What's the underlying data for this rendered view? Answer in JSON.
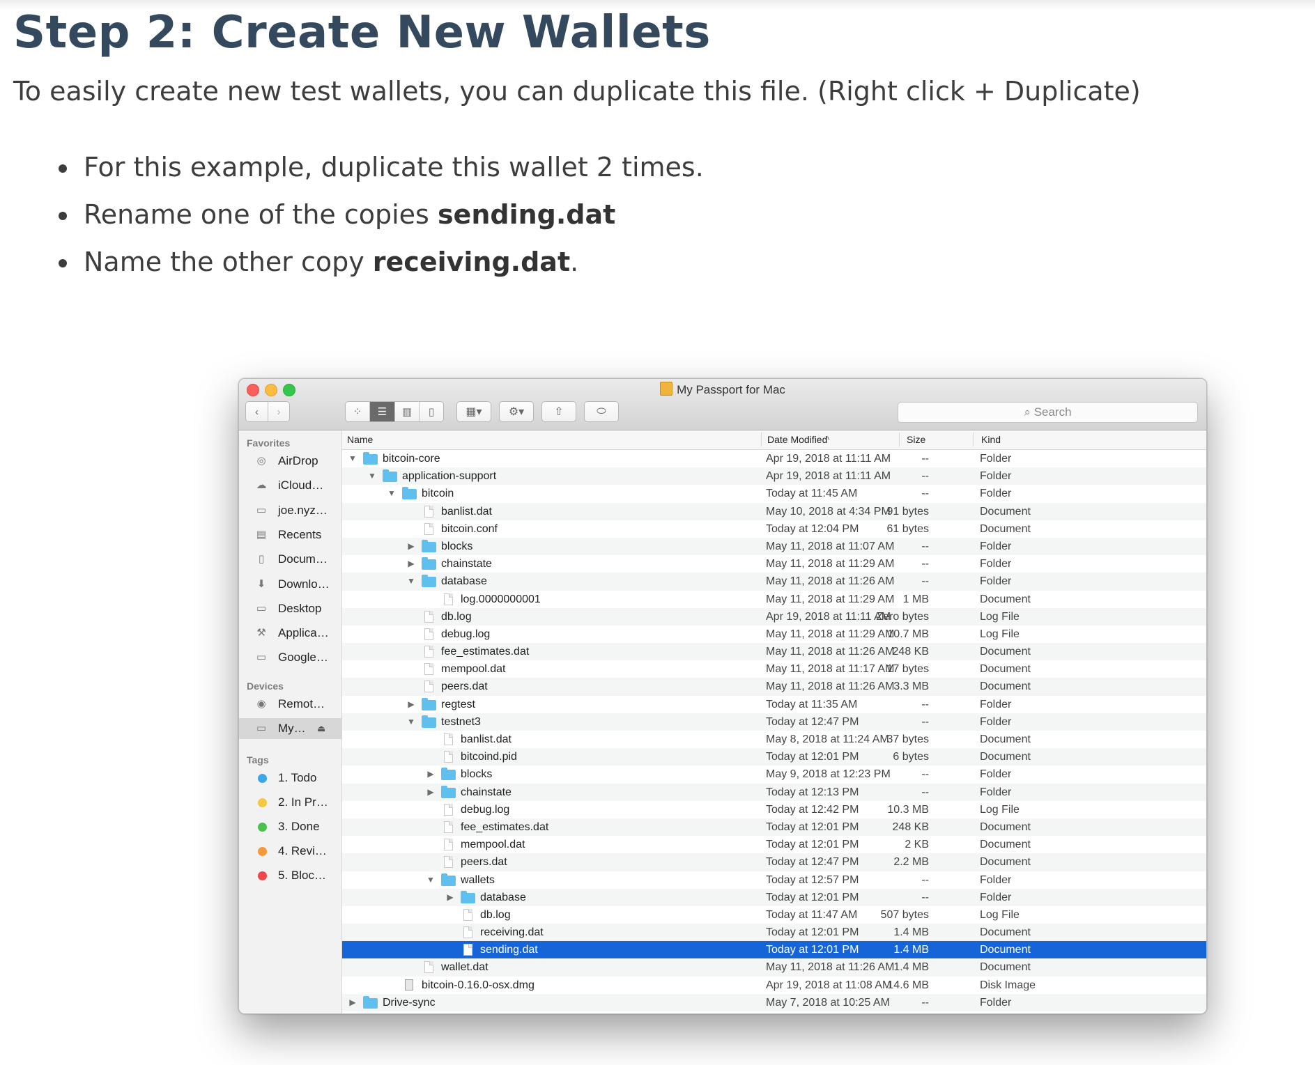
{
  "article": {
    "heading": "Step 2: Create New Wallets",
    "intro": "To easily create new test wallets, you can duplicate this file. (Right click + Duplicate)",
    "bullets": [
      {
        "before": "For this example, duplicate this wallet 2 times.",
        "bold": "",
        "after": ""
      },
      {
        "before": "Rename one of the copies ",
        "bold": "sending.dat",
        "after": ""
      },
      {
        "before": "Name the other copy ",
        "bold": "receiving.dat",
        "after": "."
      }
    ]
  },
  "finder": {
    "title": "My Passport for Mac",
    "search_placeholder": "Search",
    "colors": {
      "selection": "#1665d8",
      "folder": "#5fbfef",
      "close": "#fc605c",
      "minimize": "#fdbc40",
      "zoom": "#34c749"
    },
    "sidebar": {
      "favorites_header": "Favorites",
      "favorites": [
        {
          "label": "AirDrop",
          "icon": "airdrop-icon"
        },
        {
          "label": "iCloud…",
          "icon": "cloud-icon"
        },
        {
          "label": "joe.nyz…",
          "icon": "folder-icon"
        },
        {
          "label": "Recents",
          "icon": "recents-icon"
        },
        {
          "label": "Docum…",
          "icon": "documents-icon"
        },
        {
          "label": "Downlo…",
          "icon": "download-icon"
        },
        {
          "label": "Desktop",
          "icon": "desktop-icon"
        },
        {
          "label": "Applica…",
          "icon": "applications-icon"
        },
        {
          "label": "Google…",
          "icon": "folder-icon"
        }
      ],
      "devices_header": "Devices",
      "devices": [
        {
          "label": "Remot…",
          "icon": "remote-disc-icon"
        },
        {
          "label": "My…",
          "icon": "external-drive-icon",
          "eject": "⏏"
        }
      ],
      "tags_header": "Tags",
      "tags": [
        {
          "label": "1. Todo",
          "color": "#3ba6ea"
        },
        {
          "label": "2. In Pr…",
          "color": "#f5c842"
        },
        {
          "label": "3. Done",
          "color": "#4cc24c"
        },
        {
          "label": "4. Revi…",
          "color": "#f59a3b"
        },
        {
          "label": "5. Bloc…",
          "color": "#f04848"
        }
      ]
    },
    "columns": {
      "name": "Name",
      "date": "Date Modified",
      "size": "Size",
      "kind": "Kind",
      "sort_indicator": "^"
    },
    "rows": [
      {
        "name": "bitcoin-core",
        "date": "Apr 19, 2018 at 11:11 AM",
        "size": "--",
        "kind": "Folder",
        "level": 0,
        "type": "folder",
        "disc": "open"
      },
      {
        "name": "application-support",
        "date": "Apr 19, 2018 at 11:11 AM",
        "size": "--",
        "kind": "Folder",
        "level": 1,
        "type": "folder",
        "disc": "open"
      },
      {
        "name": "bitcoin",
        "date": "Today at 11:45 AM",
        "size": "--",
        "kind": "Folder",
        "level": 2,
        "type": "folder",
        "disc": "open"
      },
      {
        "name": "banlist.dat",
        "date": "May 10, 2018 at 4:34 PM",
        "size": "91 bytes",
        "kind": "Document",
        "level": 3,
        "type": "doc",
        "disc": ""
      },
      {
        "name": "bitcoin.conf",
        "date": "Today at 12:04 PM",
        "size": "61 bytes",
        "kind": "Document",
        "level": 3,
        "type": "doc",
        "disc": ""
      },
      {
        "name": "blocks",
        "date": "May 11, 2018 at 11:07 AM",
        "size": "--",
        "kind": "Folder",
        "level": 3,
        "type": "folder",
        "disc": "closed"
      },
      {
        "name": "chainstate",
        "date": "May 11, 2018 at 11:29 AM",
        "size": "--",
        "kind": "Folder",
        "level": 3,
        "type": "folder",
        "disc": "closed"
      },
      {
        "name": "database",
        "date": "May 11, 2018 at 11:26 AM",
        "size": "--",
        "kind": "Folder",
        "level": 3,
        "type": "folder",
        "disc": "open"
      },
      {
        "name": "log.0000000001",
        "date": "May 11, 2018 at 11:29 AM",
        "size": "1 MB",
        "kind": "Document",
        "level": 4,
        "type": "doc",
        "disc": ""
      },
      {
        "name": "db.log",
        "date": "Apr 19, 2018 at 11:11 AM",
        "size": "Zero bytes",
        "kind": "Log File",
        "level": 3,
        "type": "doc",
        "disc": ""
      },
      {
        "name": "debug.log",
        "date": "May 11, 2018 at 11:29 AM",
        "size": "10.7 MB",
        "kind": "Log File",
        "level": 3,
        "type": "doc",
        "disc": ""
      },
      {
        "name": "fee_estimates.dat",
        "date": "May 11, 2018 at 11:26 AM",
        "size": "248 KB",
        "kind": "Document",
        "level": 3,
        "type": "doc",
        "disc": ""
      },
      {
        "name": "mempool.dat",
        "date": "May 11, 2018 at 11:17 AM",
        "size": "17 bytes",
        "kind": "Document",
        "level": 3,
        "type": "doc",
        "disc": ""
      },
      {
        "name": "peers.dat",
        "date": "May 11, 2018 at 11:26 AM",
        "size": "3.3 MB",
        "kind": "Document",
        "level": 3,
        "type": "doc",
        "disc": ""
      },
      {
        "name": "regtest",
        "date": "Today at 11:35 AM",
        "size": "--",
        "kind": "Folder",
        "level": 3,
        "type": "folder",
        "disc": "closed"
      },
      {
        "name": "testnet3",
        "date": "Today at 12:47 PM",
        "size": "--",
        "kind": "Folder",
        "level": 3,
        "type": "folder",
        "disc": "open"
      },
      {
        "name": "banlist.dat",
        "date": "May 8, 2018 at 11:24 AM",
        "size": "37 bytes",
        "kind": "Document",
        "level": 4,
        "type": "doc",
        "disc": ""
      },
      {
        "name": "bitcoind.pid",
        "date": "Today at 12:01 PM",
        "size": "6 bytes",
        "kind": "Document",
        "level": 4,
        "type": "doc",
        "disc": ""
      },
      {
        "name": "blocks",
        "date": "May 9, 2018 at 12:23 PM",
        "size": "--",
        "kind": "Folder",
        "level": 4,
        "type": "folder",
        "disc": "closed"
      },
      {
        "name": "chainstate",
        "date": "Today at 12:13 PM",
        "size": "--",
        "kind": "Folder",
        "level": 4,
        "type": "folder",
        "disc": "closed"
      },
      {
        "name": "debug.log",
        "date": "Today at 12:42 PM",
        "size": "10.3 MB",
        "kind": "Log File",
        "level": 4,
        "type": "doc",
        "disc": ""
      },
      {
        "name": "fee_estimates.dat",
        "date": "Today at 12:01 PM",
        "size": "248 KB",
        "kind": "Document",
        "level": 4,
        "type": "doc",
        "disc": ""
      },
      {
        "name": "mempool.dat",
        "date": "Today at 12:01 PM",
        "size": "2 KB",
        "kind": "Document",
        "level": 4,
        "type": "doc",
        "disc": ""
      },
      {
        "name": "peers.dat",
        "date": "Today at 12:47 PM",
        "size": "2.2 MB",
        "kind": "Document",
        "level": 4,
        "type": "doc",
        "disc": ""
      },
      {
        "name": "wallets",
        "date": "Today at 12:57 PM",
        "size": "--",
        "kind": "Folder",
        "level": 4,
        "type": "folder",
        "disc": "open"
      },
      {
        "name": "database",
        "date": "Today at 12:01 PM",
        "size": "--",
        "kind": "Folder",
        "level": 5,
        "type": "folder",
        "disc": "closed"
      },
      {
        "name": "db.log",
        "date": "Today at 11:47 AM",
        "size": "507 bytes",
        "kind": "Log File",
        "level": 5,
        "type": "doc",
        "disc": ""
      },
      {
        "name": "receiving.dat",
        "date": "Today at 12:01 PM",
        "size": "1.4 MB",
        "kind": "Document",
        "level": 5,
        "type": "doc",
        "disc": ""
      },
      {
        "name": "sending.dat",
        "date": "Today at 12:01 PM",
        "size": "1.4 MB",
        "kind": "Document",
        "level": 5,
        "type": "doc",
        "disc": "",
        "selected": true
      },
      {
        "name": "wallet.dat",
        "date": "May 11, 2018 at 11:26 AM",
        "size": "1.4 MB",
        "kind": "Document",
        "level": 3,
        "type": "doc",
        "disc": ""
      },
      {
        "name": "bitcoin-0.16.0-osx.dmg",
        "date": "Apr 19, 2018 at 11:08 AM",
        "size": "14.6 MB",
        "kind": "Disk Image",
        "level": 2,
        "type": "dmg",
        "disc": ""
      },
      {
        "name": "Drive-sync",
        "date": "May 7, 2018 at 10:25 AM",
        "size": "--",
        "kind": "Folder",
        "level": 0,
        "type": "folder",
        "disc": "closed"
      }
    ]
  }
}
